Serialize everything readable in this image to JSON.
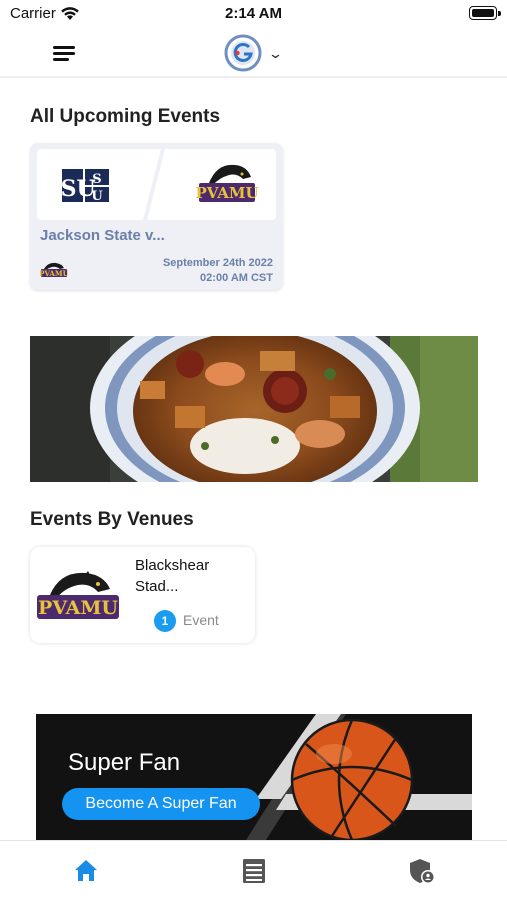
{
  "status_bar": {
    "carrier": "Carrier",
    "time": "2:14 AM"
  },
  "header": {
    "menu_icon": "hamburger-menu-icon",
    "brand_icon": "brand-logo-icon",
    "dropdown_icon": "chevron-down-icon"
  },
  "upcoming": {
    "title": "All Upcoming Events",
    "events": [
      {
        "home_logo": "JSU",
        "away_logo": "PVAMU",
        "name": "Jackson State v...",
        "date": "September 24th 2022",
        "time": "02:00 AM CST"
      }
    ]
  },
  "venues": {
    "title": "Events By Venues",
    "items": [
      {
        "logo": "PVAMU",
        "name_line1": "Blackshear",
        "name_line2": "Stad...",
        "count": "1",
        "count_label": "Event"
      }
    ]
  },
  "superfan": {
    "title": "Super Fan",
    "button_label": "Become A Super Fan"
  },
  "tabs": [
    {
      "icon": "home-icon",
      "active": true
    },
    {
      "icon": "list-icon",
      "active": false
    },
    {
      "icon": "shield-user-icon",
      "active": false
    }
  ],
  "colors": {
    "accent": "#1a9cf0",
    "tab_active": "#1a8ce8",
    "tab_inactive": "#555555",
    "event_text": "#6b7fa8",
    "card_bg": "#eef0f5"
  }
}
